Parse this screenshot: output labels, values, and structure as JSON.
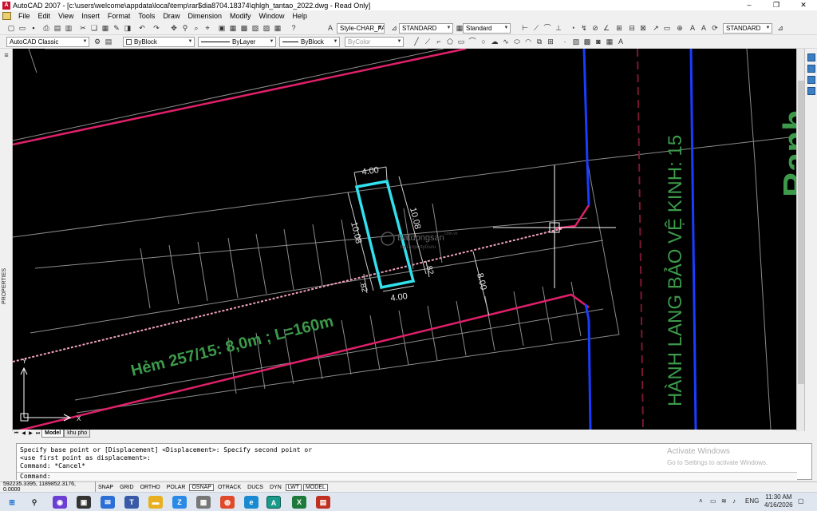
{
  "window": {
    "title": "AutoCAD 2007 - [c:\\users\\welcome\\appdata\\local\\temp\\rar$dia8704.18374\\qhlgh_tantao_2022.dwg - Read Only]",
    "minimize": "–",
    "restore": "❐",
    "close": "✕"
  },
  "menu": [
    "File",
    "Edit",
    "View",
    "Insert",
    "Format",
    "Tools",
    "Draw",
    "Dimension",
    "Modify",
    "Window",
    "Help"
  ],
  "toolbar1": {
    "text_style": "Style-CHAR_FA",
    "dim_style": "STANDARD",
    "table_style": "Standard",
    "multileader_style": "STANDARD"
  },
  "toolbar2": {
    "workspace": "AutoCAD Classic",
    "layer": "ByBlock",
    "linetype_label": "ByLayer",
    "lineweight_label": "ByBlock",
    "plotstyle": "ByColor"
  },
  "side_panel": {
    "label": "PROPERTIES"
  },
  "drawing": {
    "street_label": "Hẻm 257/15: 8,0m ; L=160m",
    "road_label": "HÀNH LANG BẢO VỆ KINH: 15",
    "partial_label": "Ranh",
    "dim_top": "4.00",
    "dim_bottom": "4.00",
    "dim_left": "10.08",
    "dim_right": "10.08",
    "dim_small_left": ".82",
    "dim_small_right": ".82",
    "dim_setback": "8.00",
    "watermark": "Batdongsan",
    "watermark_sub": "by PropertyGuru",
    "watermark_tag": ".com.vn",
    "ucs_y": "Y",
    "ucs_x": "X"
  },
  "tabs": {
    "model": "Model",
    "layout": "khu pho"
  },
  "command": {
    "lines": [
      "Specify base point or [Displacement] <Displacement>: Specify second point or",
      "<use first point as displacement>:",
      "Command: *Cancel*"
    ],
    "prompt": "Command:"
  },
  "activate": {
    "title": "Activate Windows",
    "sub": "Go to Settings to activate Windows."
  },
  "status": {
    "coords": "592235.3395, 1189852.3176, 0.0000",
    "toggles": [
      {
        "label": "SNAP",
        "on": false
      },
      {
        "label": "GRID",
        "on": false
      },
      {
        "label": "ORTHO",
        "on": false
      },
      {
        "label": "POLAR",
        "on": false
      },
      {
        "label": "OSNAP",
        "on": true
      },
      {
        "label": "OTRACK",
        "on": false
      },
      {
        "label": "DUCS",
        "on": false
      },
      {
        "label": "DYN",
        "on": false
      },
      {
        "label": "LWT",
        "on": true
      },
      {
        "label": "MODEL",
        "on": true
      }
    ]
  },
  "taskbar": {
    "lang": "ENG",
    "time": "11:30 AM",
    "date": "4/16/2026"
  },
  "colors": {
    "canvas": "#000000",
    "pink_line": "#e0206a",
    "blue_line": "#1a3cff",
    "cyan_lot": "#33e0ee",
    "green_text": "#3c9a4a",
    "gray_line": "#8c8c8c"
  }
}
